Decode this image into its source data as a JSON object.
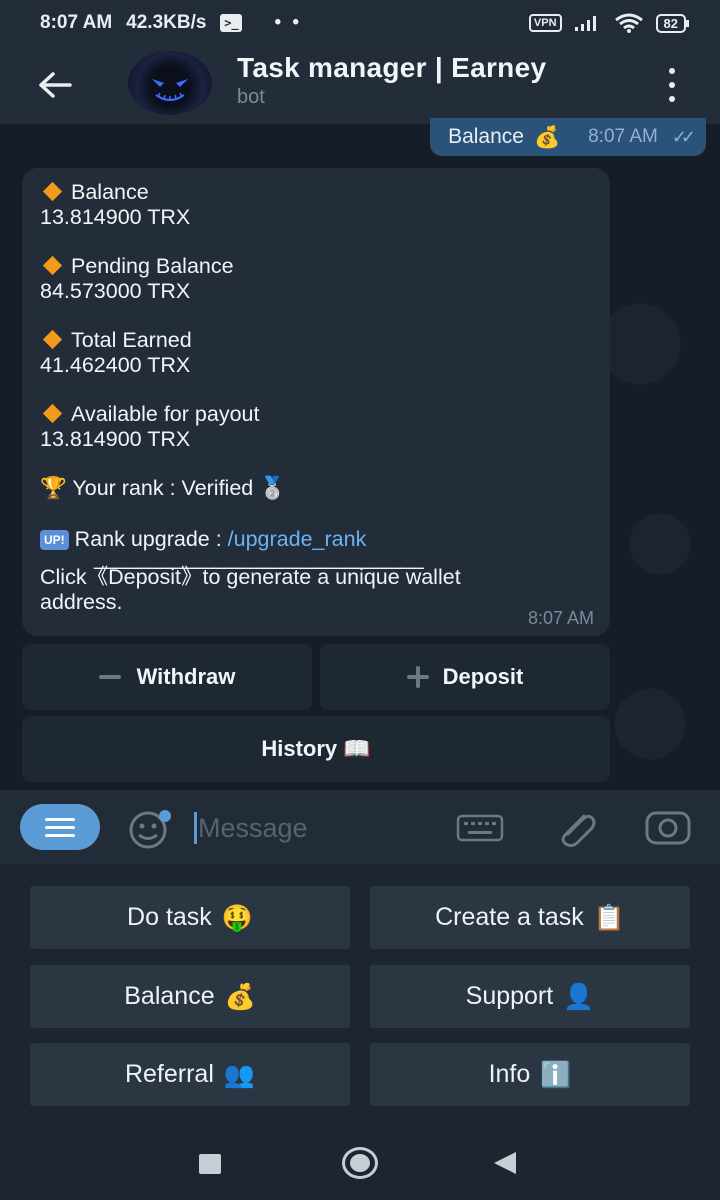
{
  "status_bar": {
    "time": "8:07 AM",
    "speed": "42.3KB/s",
    "terminal_icon": ">_",
    "dots": "• •",
    "vpn": "VPN",
    "battery": "82"
  },
  "header": {
    "title": "Task manager | Earney",
    "subtitle": "bot"
  },
  "outgoing_message": {
    "text": "Balance",
    "emoji": "💰",
    "time": "8:07 AM"
  },
  "incoming_message": {
    "balance_label": "Balance",
    "balance_value": "13.814900 TRX",
    "pending_label": "Pending Balance",
    "pending_value": "84.573000 TRX",
    "total_label": "Total Earned",
    "total_value": "41.462400 TRX",
    "available_label": "Available for payout",
    "available_value": "13.814900 TRX",
    "rank_emoji": "🏆",
    "rank_text": "Your rank : Verified",
    "rank_medal": "🥈",
    "upgrade_badge": "UP!",
    "upgrade_text": "Rank upgrade : ",
    "upgrade_link": "/upgrade_rank",
    "divider": "______________________________",
    "click_text_1": "Click《Deposit》to generate a unique wallet",
    "click_text_2": "address.",
    "time": "8:07 AM"
  },
  "inline_keyboard": {
    "withdraw": "Withdraw",
    "deposit": "Deposit",
    "history": "History",
    "history_emoji": "📖"
  },
  "input": {
    "placeholder": "Message"
  },
  "reply_keyboard": {
    "do_task": "Do task",
    "do_task_emoji": "🤑",
    "create_task": "Create a task",
    "create_task_emoji": "📋",
    "balance": "Balance",
    "balance_emoji": "💰",
    "support": "Support",
    "support_emoji": "👤",
    "referral": "Referral",
    "referral_emoji": "👥",
    "info": "Info",
    "info_emoji": "ℹ️"
  }
}
